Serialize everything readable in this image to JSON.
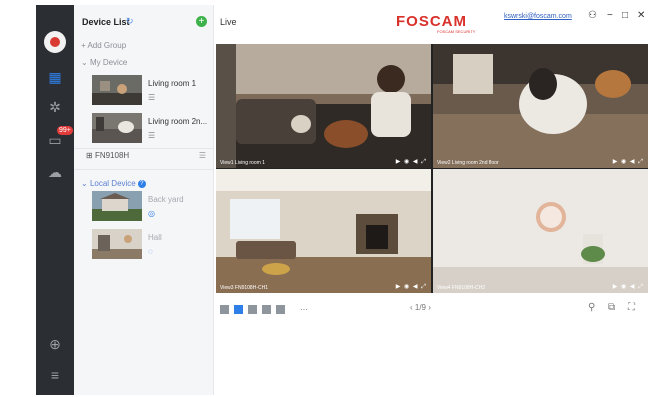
{
  "sidebar_rail": {
    "icons": [
      "app-logo-icon",
      "device-list-icon",
      "settings-icon",
      "messages-icon",
      "cloud-icon",
      "add-circle-icon",
      "menu-icon"
    ],
    "badge": "99+"
  },
  "device_panel": {
    "title": "Device List",
    "add_group": "+ Add Group",
    "my_device": "My Device",
    "devices": [
      {
        "name": "Living room 1",
        "sub": "☰"
      },
      {
        "name": "Living room 2n...",
        "sub": "☰"
      }
    ],
    "nvr": {
      "icon": "⊞",
      "name": "FN9108H",
      "menu": "☰"
    },
    "local_device": "Local Device",
    "local_devices": [
      {
        "name": "Back yard",
        "sub": "◎"
      },
      {
        "name": "Hall",
        "sub": "◌"
      }
    ]
  },
  "main": {
    "live_label": "Live",
    "brand": "FOSCAM",
    "brand_sub": "FOSCAM SECURITY",
    "email": "kswrski@foscam.com",
    "window_controls": [
      "⚇",
      "−",
      "□",
      "✕"
    ],
    "views": [
      {
        "label": "View1 Living room 1",
        "controls": "▶ ◉ ◀ ⤢"
      },
      {
        "label": "View2 Living room 2nd floor",
        "controls": "▶ ◉ ◀ ⤢"
      },
      {
        "label": "View3 FN9108H-CH1",
        "controls": "▶ ◉ ◀ ⤢"
      },
      {
        "label": "View4 FN9108H-CH2",
        "controls": "▶ ◉ ◀ ⤢"
      }
    ],
    "layout_more": "···",
    "pager": "‹  1/9  ›",
    "right_tools": [
      "⚲",
      "⧉",
      "⛶"
    ]
  },
  "colors": {
    "accent": "#2f7fe8",
    "brand": "#d9312b",
    "rail": "#2b2e33",
    "badge": "#e23b3b"
  }
}
